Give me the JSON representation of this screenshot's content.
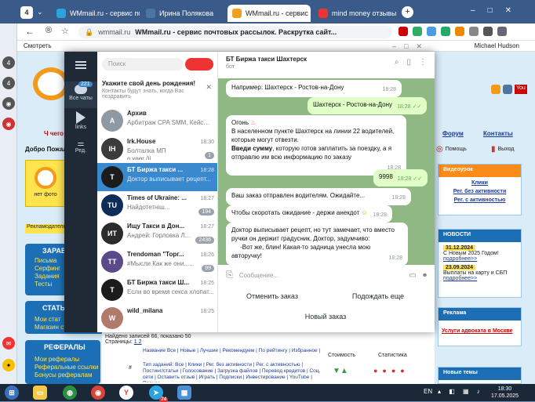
{
  "browser": {
    "tab_count": "4",
    "tabs": [
      {
        "label": "WMmail.ru - сервис по"
      },
      {
        "label": "Ирина Полякова"
      },
      {
        "label": "WMmail.ru - сервис"
      },
      {
        "label": "mind money отзывы —"
      }
    ],
    "address_domain": "wmmail.ru",
    "address_title": "WMmail.ru - сервис почтовых рассылок. Раскрутка сайт...",
    "bookmarks": [
      "Смотреть",
      "Michael Hudson"
    ]
  },
  "webpage": {
    "welcome": "Добро Пожал",
    "mail_link": "Ч чего н",
    "no_photo": "нет фото",
    "ad_label": "Рекламодатель",
    "earn_header": "ЗАРАБО",
    "earn_items": [
      "Письма",
      "Серфинг",
      "Задания",
      "Тесты"
    ],
    "stats_header": "СТАТЫ",
    "stats_items": [
      "Мои стат",
      "Магазин статей"
    ],
    "referrals_header": "РЕФЕРАЛЫ",
    "referrals_items": [
      "Мои рефералы",
      "Реферальные ссылки",
      "Бонусы рефералам"
    ],
    "forum": "Форум",
    "contacts": "Контакты",
    "help": "Помощь",
    "exit": "Выход",
    "video_header": "Видеоурок",
    "video_links": [
      "Клики",
      "Рег. без активности",
      "Рег. с активностью"
    ],
    "news_header": "НОВОСТИ",
    "news": [
      {
        "date": "31.12.2024",
        "text": "С Новым 2025 Годом!",
        "more": "подробнее>>"
      },
      {
        "date": "23.09.2024",
        "text": "Выплаты на карту и СБП",
        "more": "подробнее>>"
      }
    ],
    "ads_header": "Реклама",
    "ads_link": "Услуги адвоката в Москве",
    "new_topics": "Новые темы",
    "found": "Найдено записей 66, показано 50",
    "pages_label": "Страницы:",
    "pages": "1 2",
    "filter_line1": "Название Все | Новые | Лучшие | Рекомендуем | По рейтингу | Избранное | Скрытые",
    "filter_line2": "Тип заданий: Все | Клики | Рег. без активности | Рег. с активностью | Постинг/статьи | Голосование | Загрузка файлов | Перевод кредитов | Соц. сети | Оставить отзыв | Играть | Подписки | Инвестирование | YouTube | Прочее",
    "col_hash": "#",
    "col_cost": "Стоимость",
    "col_stats": "Статистика"
  },
  "telegram": {
    "rail": {
      "badge": "221",
      "all_chats": "Все чаты",
      "links": "links",
      "edit": "Ред."
    },
    "search_placeholder": "Поиск",
    "birthday_title": "Укажите свой день рождения!",
    "birthday_text": "Контакты будут знать, когда Вас поздравить",
    "chats": [
      {
        "title": "Архив",
        "preview": "Арбитраж CPA SMM, Кейсы ...",
        "time": "",
        "badge": "",
        "color": "#8e99a4",
        "initials": "А"
      },
      {
        "title": "Irk.House",
        "preview": "Болталка  МП",
        "preview2": "ɞ ɣɵɵr ği...",
        "time": "18:30",
        "badge": "1",
        "color": "#3b3b3b",
        "initials": "IH"
      },
      {
        "title": "БТ Биржа такси ...",
        "preview": "Доктор выписывает рецепт...",
        "time": "18:28",
        "badge": "",
        "color": "#1c1c1c",
        "initials": "Т",
        "selected": true
      },
      {
        "title": "Times of Ukraine: ...",
        "preview": "Найдотетніш...",
        "time": "18:27",
        "badge": "194",
        "color": "#0d2c57",
        "initials": "TU"
      },
      {
        "title": "Ищу Такси в Дон...",
        "preview": "Андрей: Горловка Л...",
        "time": "18:27",
        "badge": "2436",
        "color": "#2b2b2b",
        "initials": "ИТ"
      },
      {
        "title": "Trendoman \"Торг...",
        "preview": "#Мысли  Как же они.....",
        "time": "18:26",
        "badge": "99",
        "color": "#5a4a8a",
        "initials": "TT"
      },
      {
        "title": "БТ Биржа такси Ш...",
        "preview": "Если во время секса хлопат...",
        "time": "18:25",
        "badge": "",
        "color": "#1c1c1c",
        "initials": "Т"
      },
      {
        "title": "wild_milana",
        "preview": "",
        "time": "18:25",
        "badge": "",
        "color": "#b07b6a",
        "initials": "W"
      }
    ],
    "chat_title": "БТ Биржа такси Шахтерск",
    "chat_subtitle": "бот",
    "messages": [
      {
        "text": "Например: Шахтерск - Ростов-на-Дону",
        "time": "18:28",
        "out": false
      },
      {
        "text": "Шахтерск - Ростов-на-Дону",
        "time": "18:28",
        "out": true
      },
      {
        "line1": "Огонь",
        "line2": "В населенном пункте Шахтерск на линии 22  водителей, которые могут отвезти.",
        "bold": "Введи сумму",
        "line3": ", которую готов заплатить за поездку, а я отправлю им всю информацию по заказу",
        "time": "18:28",
        "out": false
      },
      {
        "text": "9998",
        "time": "18:28",
        "out": true
      },
      {
        "text": "Ваш заказ отправлен водителям. Ожидайте...",
        "time": "18:28",
        "out": false
      },
      {
        "text": "Чтобы скоротать ожидание - держи анекдот",
        "time": "18:28",
        "out": false
      },
      {
        "text": "Доктор выписывает рецепт, но тут замечает, что вместо ручки он держит градусник. Доктор, задумчиво:\n     -Вот же, блин! Какая-то задница унесла мою авторучку!",
        "time": "18:28",
        "out": false
      }
    ],
    "composer_placeholder": "Сообщение...",
    "keyboard": {
      "cancel": "Отменить заказ",
      "wait": "Подождать еще",
      "new_order": "Новый заказ"
    }
  },
  "taskbar": {
    "lang": "EN",
    "time": "18:30",
    "date": "17.05.2025",
    "telegram_badge": "74"
  }
}
